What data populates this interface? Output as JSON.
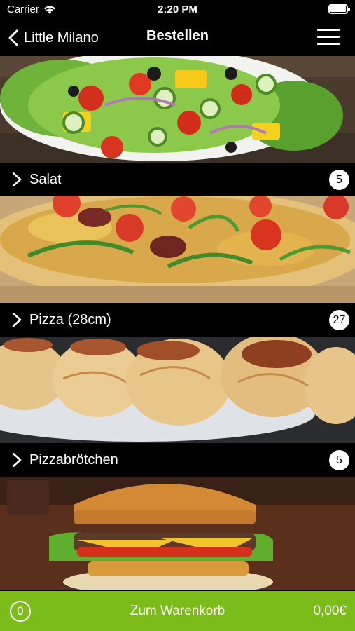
{
  "status_bar": {
    "carrier": "Carrier",
    "time": "2:20 PM"
  },
  "nav": {
    "back_label": "Little Milano",
    "title": "Bestellen"
  },
  "categories": [
    {
      "label": "Salat",
      "count": "5"
    },
    {
      "label": "Pizza (28cm)",
      "count": "27"
    },
    {
      "label": "Pizzabrötchen",
      "count": "5"
    }
  ],
  "cart": {
    "count": "0",
    "label": "Zum Warenkorb",
    "total": "0,00€"
  },
  "colors": {
    "accent": "#7cbc1a",
    "background": "#000000"
  }
}
